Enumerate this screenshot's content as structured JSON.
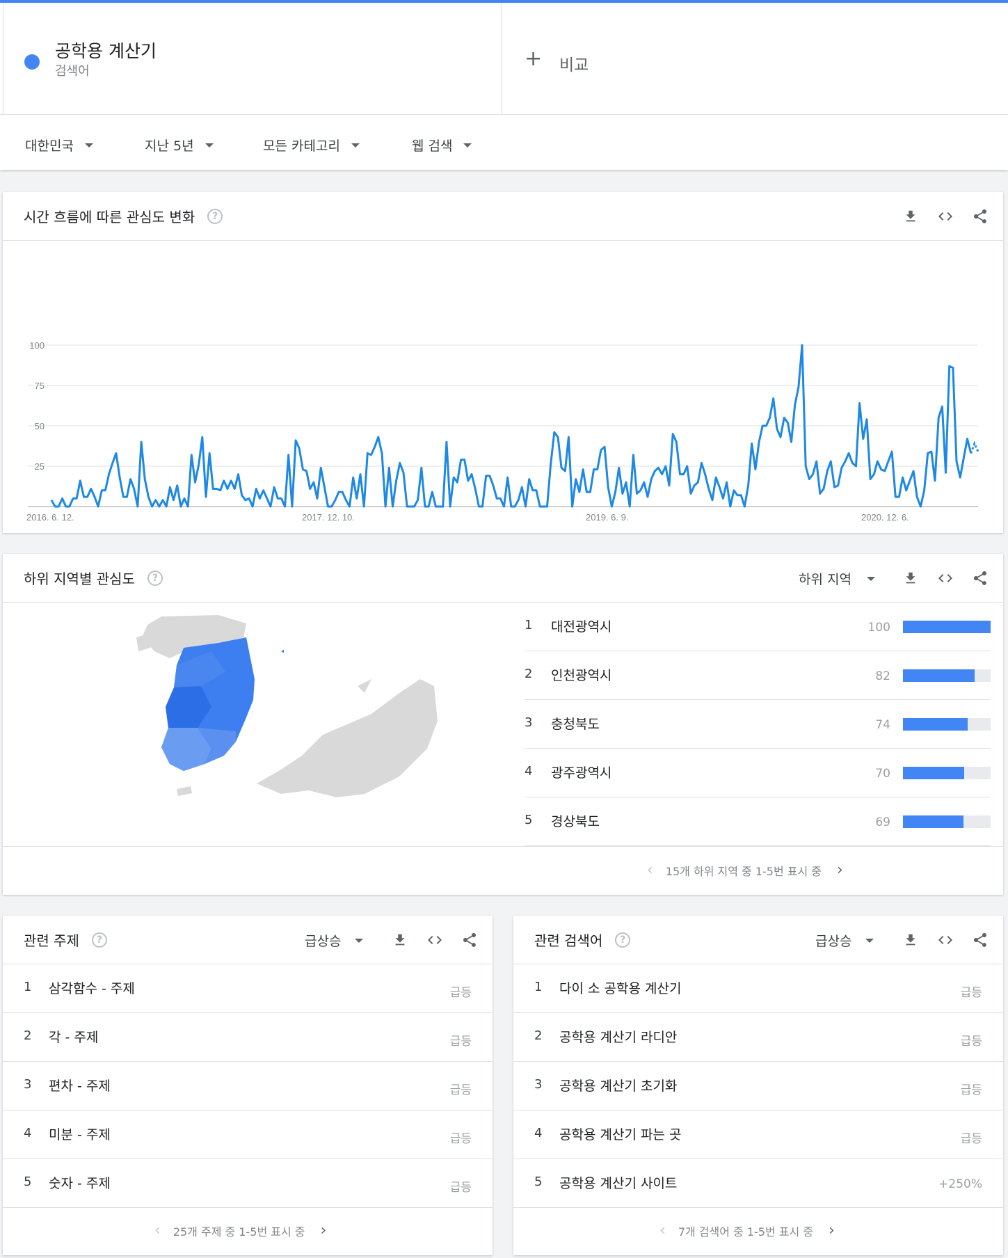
{
  "term": {
    "title": "공학용 계산기",
    "subtitle": "검색어"
  },
  "compare": {
    "plus": "+",
    "label": "비교"
  },
  "filters": {
    "region": "대한민국",
    "period": "지난 5년",
    "category": "모든 카테고리",
    "search_type": "웹 검색"
  },
  "interest_over_time": {
    "title": "시간 흐름에 따른 관심도 변화",
    "help": "?",
    "chart_data": {
      "type": "line",
      "ylim": [
        0,
        100
      ],
      "yticks": [
        "100",
        "75",
        "50",
        "25"
      ],
      "x_tick_labels": [
        "2016. 6. 12.",
        "2017. 12. 10.",
        "2019. 6. 9.",
        "2020. 12. 6."
      ],
      "x_start": "2016. 6. 12.",
      "x_end": "2021. 5. 30.",
      "series": [
        {
          "color": "#1e88e5",
          "values": [
            4,
            0,
            0,
            5,
            0,
            0,
            5,
            5,
            16,
            6,
            6,
            11,
            6,
            0,
            10,
            10,
            20,
            27,
            33,
            18,
            6,
            6,
            17,
            11,
            0,
            40,
            17,
            6,
            0,
            4,
            0,
            4,
            0,
            12,
            4,
            13,
            0,
            5,
            0,
            32,
            15,
            26,
            43,
            6,
            33,
            11,
            11,
            10,
            16,
            11,
            16,
            11,
            20,
            7,
            4,
            5,
            0,
            11,
            5,
            10,
            5,
            0,
            12,
            5,
            5,
            0,
            32,
            0,
            41,
            36,
            23,
            22,
            11,
            15,
            5,
            24,
            12,
            0,
            0,
            4,
            9,
            9,
            4,
            0,
            18,
            5,
            20,
            0,
            33,
            32,
            37,
            43,
            33,
            0,
            24,
            0,
            16,
            27,
            21,
            0,
            0,
            0,
            4,
            24,
            0,
            0,
            9,
            0,
            0,
            0,
            40,
            0,
            18,
            15,
            29,
            29,
            16,
            20,
            11,
            0,
            0,
            19,
            19,
            13,
            5,
            5,
            0,
            18,
            0,
            0,
            4,
            12,
            0,
            17,
            10,
            10,
            0,
            0,
            0,
            26,
            46,
            43,
            24,
            22,
            43,
            0,
            17,
            9,
            23,
            9,
            9,
            23,
            23,
            35,
            37,
            12,
            0,
            9,
            24,
            8,
            15,
            0,
            32,
            8,
            10,
            15,
            6,
            17,
            22,
            24,
            20,
            25,
            13,
            45,
            40,
            20,
            20,
            25,
            8,
            13,
            15,
            27,
            20,
            11,
            4,
            18,
            12,
            5,
            15,
            0,
            10,
            7,
            7,
            0,
            13,
            39,
            23,
            40,
            50,
            50,
            55,
            67,
            48,
            43,
            55,
            52,
            40,
            63,
            74,
            100,
            25,
            17,
            20,
            28,
            8,
            11,
            22,
            28,
            12,
            13,
            24,
            28,
            33,
            27,
            25,
            64,
            42,
            54,
            17,
            20,
            28,
            23,
            22,
            28,
            34,
            6,
            6,
            18,
            10,
            16,
            22,
            6,
            0,
            10,
            33,
            34,
            16,
            55,
            62,
            21,
            87,
            86,
            28,
            18,
            30,
            42,
            33,
            39,
            34
          ]
        }
      ],
      "partial_tail_points": 3
    }
  },
  "by_region": {
    "title": "하위 지역별 관심도",
    "help": "?",
    "dropdown": "하위 지역",
    "rows": [
      {
        "rank": "1",
        "name": "대전광역시",
        "value": 100
      },
      {
        "rank": "2",
        "name": "인천광역시",
        "value": 82
      },
      {
        "rank": "3",
        "name": "충청북도",
        "value": 74
      },
      {
        "rank": "4",
        "name": "광주광역시",
        "value": 70
      },
      {
        "rank": "5",
        "name": "경상북도",
        "value": 69
      }
    ],
    "pager": "15개 하위 지역 중 1-5번 표시 중"
  },
  "related_topics": {
    "title": "관련 주제",
    "help": "?",
    "dropdown": "급상승",
    "rows": [
      {
        "rank": "1",
        "name": "삼각함수 - 주제",
        "value": "급등"
      },
      {
        "rank": "2",
        "name": "각 - 주제",
        "value": "급등"
      },
      {
        "rank": "3",
        "name": "편차 - 주제",
        "value": "급등"
      },
      {
        "rank": "4",
        "name": "미분 - 주제",
        "value": "급등"
      },
      {
        "rank": "5",
        "name": "숫자 - 주제",
        "value": "급등"
      }
    ],
    "pager": "25개 주제 중 1-5번 표시 중"
  },
  "related_queries": {
    "title": "관련 검색어",
    "help": "?",
    "dropdown": "급상승",
    "rows": [
      {
        "rank": "1",
        "name": "다이 소 공학용 계산기",
        "value": "급등"
      },
      {
        "rank": "2",
        "name": "공학용 계산기 라디안",
        "value": "급등"
      },
      {
        "rank": "3",
        "name": "공학용 계산기 초기화",
        "value": "급등"
      },
      {
        "rank": "4",
        "name": "공학용 계산기 파는 곳",
        "value": "급등"
      },
      {
        "rank": "5",
        "name": "공학용 계산기 사이트",
        "value": "+250%"
      }
    ],
    "pager": "7개 검색어 중 1-5번 표시 중"
  },
  "icons": [
    "download-icon",
    "embed-icon",
    "share-icon",
    "help-icon",
    "caret-down-icon",
    "chevron-left-icon",
    "chevron-right-icon"
  ],
  "colors": {
    "accent": "#4285f4",
    "line": "#1e88e5"
  }
}
